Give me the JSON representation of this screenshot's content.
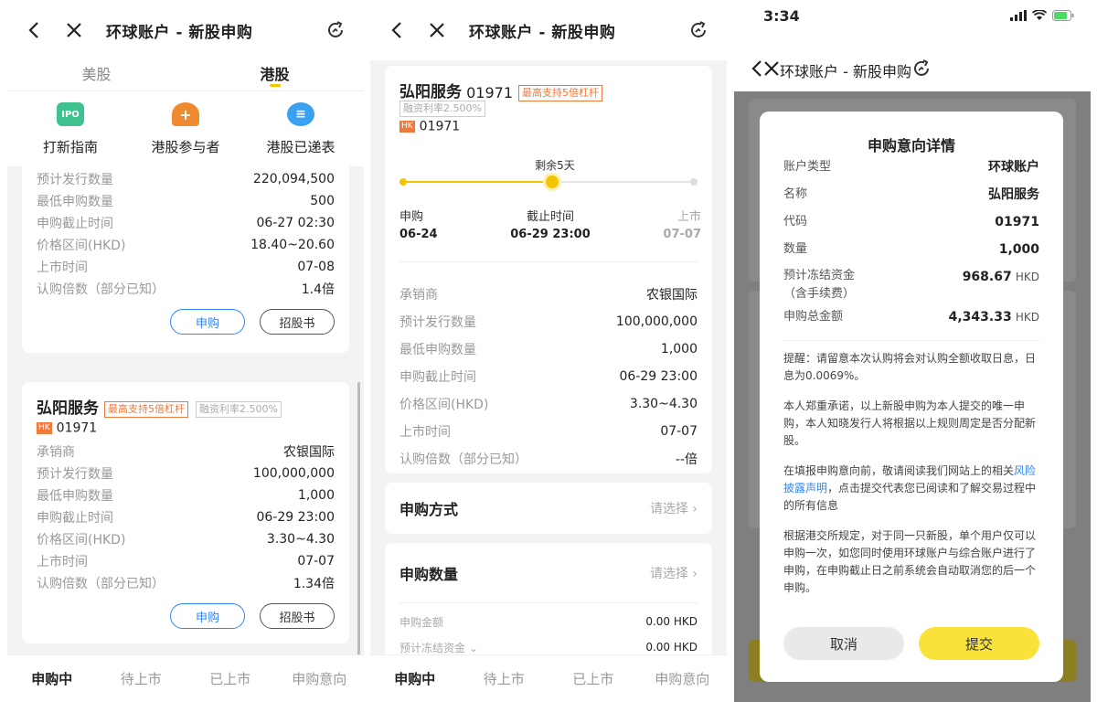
{
  "common": {
    "title": "环球账户 - 新股申购",
    "bottom_tabs": [
      "申购中",
      "待上市",
      "已上市",
      "申购意向"
    ],
    "tag_leverage": "最高支持5倍杠杆",
    "tag_rate": "融资利率2.500%",
    "hk_badge": "HK"
  },
  "screen1": {
    "market_tabs": [
      "美股",
      "港股"
    ],
    "quick": [
      {
        "label": "打新指南",
        "icon_text": "IPO",
        "color": "#3ec28f"
      },
      {
        "label": "港股参与者",
        "icon_text": "+",
        "color": "#f08a30"
      },
      {
        "label": "港股已递表",
        "icon_text": "≡",
        "color": "#3aa0f0"
      }
    ],
    "card1_rows": [
      {
        "k": "预计发行数量",
        "v": "220,094,500"
      },
      {
        "k": "最低申购数量",
        "v": "500"
      },
      {
        "k": "申购截止时间",
        "v": "06-27 02:30"
      },
      {
        "k": "价格区间(HKD)",
        "v": "18.40~20.60"
      },
      {
        "k": "上市时间",
        "v": "07-08"
      },
      {
        "k": "认购倍数（部分已知）",
        "v": "1.4倍"
      }
    ],
    "card2": {
      "name": "弘阳服务",
      "code": "01971",
      "rows": [
        {
          "k": "承销商",
          "v": "农银国际"
        },
        {
          "k": "预计发行数量",
          "v": "100,000,000"
        },
        {
          "k": "最低申购数量",
          "v": "1,000"
        },
        {
          "k": "申购截止时间",
          "v": "06-29 23:00"
        },
        {
          "k": "价格区间(HKD)",
          "v": "3.30~4.30"
        },
        {
          "k": "上市时间",
          "v": "07-07"
        },
        {
          "k": "认购倍数（部分已知）",
          "v": "1.34倍"
        }
      ]
    },
    "btn_subscribe": "申购",
    "btn_prospectus": "招股书"
  },
  "screen2": {
    "name": "弘阳服务",
    "code": "01971",
    "remaining": "剩余5天",
    "timeline": [
      {
        "label": "申购",
        "date": "06-24"
      },
      {
        "label": "截止时间",
        "date": "06-29 23:00"
      },
      {
        "label": "上市",
        "date": "07-07"
      }
    ],
    "rows": [
      {
        "k": "承销商",
        "v": "农银国际"
      },
      {
        "k": "预计发行数量",
        "v": "100,000,000"
      },
      {
        "k": "最低申购数量",
        "v": "1,000"
      },
      {
        "k": "申购截止时间",
        "v": "06-29 23:00"
      },
      {
        "k": "价格区间(HKD)",
        "v": "3.30~4.30"
      },
      {
        "k": "上市时间",
        "v": "07-07"
      },
      {
        "k": "认购倍数（部分已知）",
        "v": "--倍"
      }
    ],
    "method_title": "申购方式",
    "qty_title": "申购数量",
    "pick": "请选择",
    "amount_label": "申购金额",
    "amount_value": "0.00 HKD",
    "freeze_label": "预计冻结资金",
    "freeze_value": "0.00 HKD"
  },
  "screen3": {
    "time": "3:34",
    "dialog_title": "申购意向详情",
    "rows": [
      {
        "k": "账户类型",
        "v": "环球账户"
      },
      {
        "k": "名称",
        "v": "弘阳服务"
      },
      {
        "k": "代码",
        "v": "01971"
      },
      {
        "k": "数量",
        "v": "1,000"
      }
    ],
    "freeze_label": "预计冻结资金",
    "freeze_label2": "（含手续费）",
    "freeze_value": "968.67",
    "total_label": "申购总金额",
    "total_value": "4,343.33",
    "unit": "HKD",
    "p1": "提醒：请留意本次认购将会对认购全额收取日息，日息为0.0069%。",
    "p2": "本人郑重承诺，以上新股申购为本人提交的唯一申购，本人知晓发行人将根据以上规则周定是否分配新股。",
    "p3_a": "在填报申购意向前，敬请阅读我们网站上的相关",
    "p3_link": "风险披露声明",
    "p3_b": "，点击提交代表您已阅读和了解交易过程中的所有信息",
    "p4": "根据港交所规定，对于同一只新股，单个用户仅可以申购一次，如您同时使用环球账户与综合账户进行了申购，在申购截止日之前系统会自动取消您的后一个申购。",
    "cancel": "取消",
    "submit": "提交"
  }
}
